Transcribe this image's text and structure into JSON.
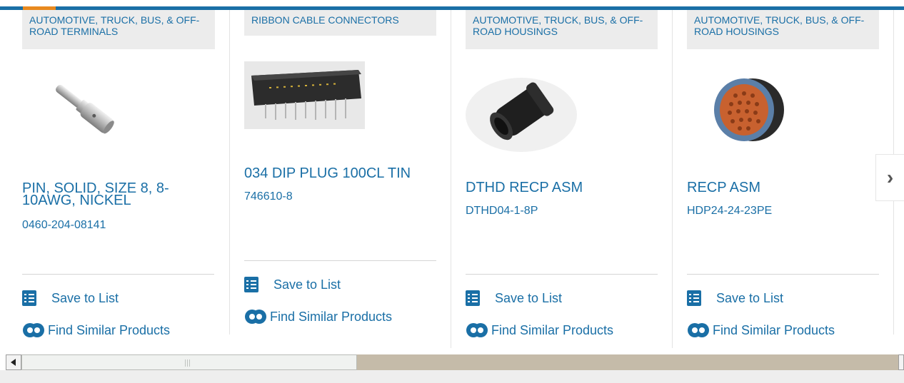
{
  "colors": {
    "brand": "#1a6fa6",
    "accent": "#e8891f",
    "category_bg": "#ececec"
  },
  "products": [
    {
      "category": "AUTOMOTIVE, TRUCK, BUS, & OFF-ROAD TERMINALS",
      "title": "PIN, SOLID, SIZE 8, 8-10AWG, NICKEL",
      "part_number": "0460-204-08141",
      "save_label": "Save to List",
      "similar_label": "Find Similar Products",
      "image": "metal-pin-terminal"
    },
    {
      "category": "RIBBON CABLE CONNECTORS",
      "title": "034 DIP PLUG 100CL TIN",
      "part_number": "746610-8",
      "save_label": "Save to List",
      "similar_label": "Find Similar Products",
      "image": "dip-plug-connector"
    },
    {
      "category": "AUTOMOTIVE, TRUCK, BUS, & OFF-ROAD HOUSINGS",
      "title": "DTHD RECP ASM",
      "part_number": "DTHD04-1-8P",
      "save_label": "Save to List",
      "similar_label": "Find Similar Products",
      "image": "black-receptacle-housing"
    },
    {
      "category": "AUTOMOTIVE, TRUCK, BUS, & OFF-ROAD HOUSINGS",
      "title": "RECP ASM",
      "part_number": "HDP24-24-23PE",
      "save_label": "Save to List",
      "similar_label": "Find Similar Products",
      "image": "circular-connector"
    }
  ],
  "carousel": {
    "next_icon": "chevron-right-icon"
  },
  "scrollbar": {
    "left_icon": "scroll-left-arrow",
    "grip_icon": "scroll-grip"
  }
}
